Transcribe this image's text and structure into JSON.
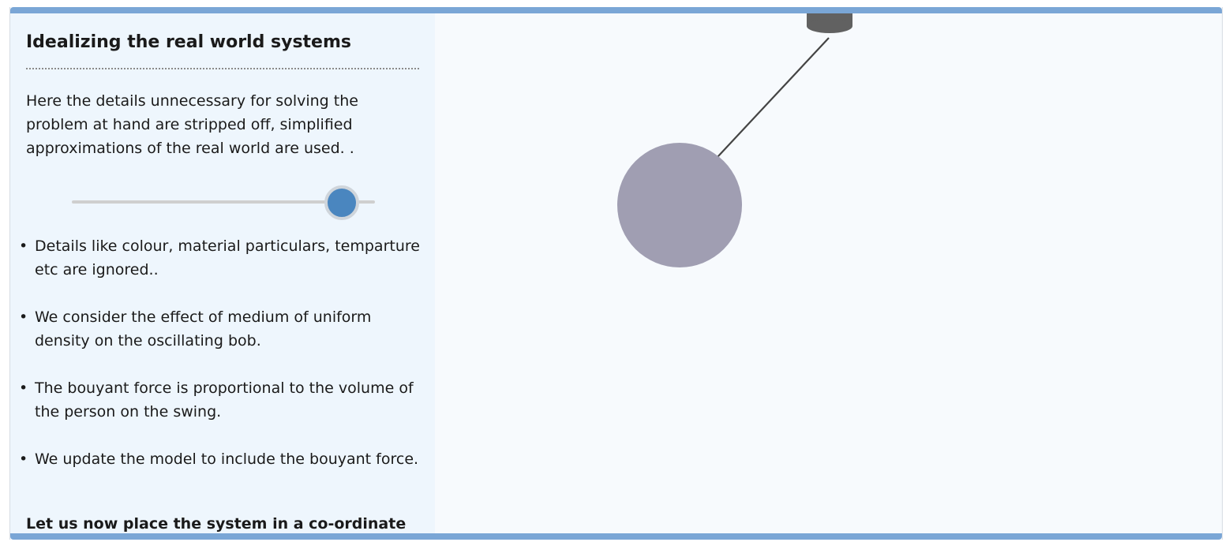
{
  "panel": {
    "title": "Idealizing the real world systems",
    "intro": "Here the details unnecessary for solving the problem at hand are stripped off, simplified approximations of the real world are used. .",
    "points": [
      "Details like colour, material particulars, temparture etc are ignored..",
      "We consider the effect of medium of uniform density on the oscillating bob.",
      "The bouyant force is proportional to the volume of the person on the swing.",
      "We update the model to include the bouyant force."
    ],
    "bottom_note": "Let us now place the system in a co-ordinate"
  },
  "slider": {
    "level": 0.89
  },
  "colors": {
    "accent": "#7aa6d6",
    "sidebar_bg": "#eef6fd",
    "slider_thumb": "#4a86bf",
    "pendulum_bob": "#a09eb2",
    "pivot": "#616161"
  },
  "icons": {
    "bullet": "•"
  }
}
